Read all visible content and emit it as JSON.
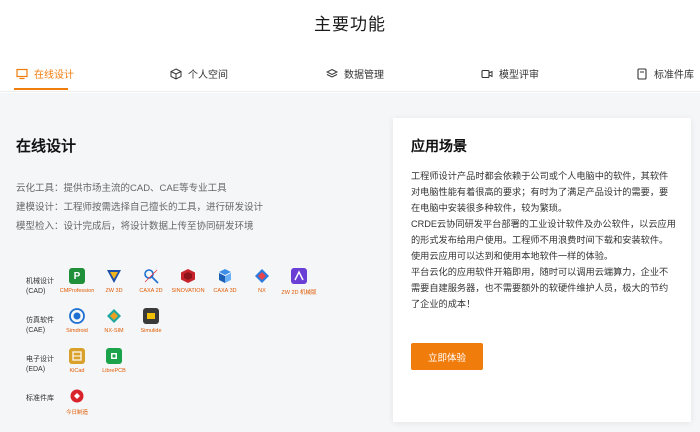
{
  "page": {
    "title": "主要功能"
  },
  "tabs": [
    {
      "label": "在线设计",
      "active": true
    },
    {
      "label": "个人空间",
      "active": false
    },
    {
      "label": "数据管理",
      "active": false
    },
    {
      "label": "模型评审",
      "active": false
    },
    {
      "label": "标准件库",
      "active": false
    }
  ],
  "online_design": {
    "title": "在线设计",
    "lines": [
      "云化工具：提供市场主流的CAD、CAE等专业工具",
      "建模设计：工程师按需选择自己擅长的工具，进行研发设计",
      "模型检入：设计完成后，将设计数据上传至协同研发环境"
    ]
  },
  "categories": [
    {
      "name": "机械设计",
      "abbr": "(CAD)",
      "software": [
        {
          "name": "CMProfession",
          "icon": "cmprofession-icon"
        },
        {
          "name": "ZW 3D",
          "icon": "zw3d-icon"
        },
        {
          "name": "CAXA 2D",
          "icon": "caxa2d-icon"
        },
        {
          "name": "SINOVATION",
          "icon": "sinovation-icon"
        },
        {
          "name": "CAXA 3D",
          "icon": "caxa3d-icon"
        },
        {
          "name": "NX",
          "icon": "nx-icon"
        },
        {
          "name": "ZW 2D 机械版",
          "icon": "zw2d-icon"
        }
      ]
    },
    {
      "name": "仿真软件",
      "abbr": "(CAE)",
      "software": [
        {
          "name": "Simdroid",
          "icon": "simdroid-icon"
        },
        {
          "name": "NX-SIM",
          "icon": "nxsim-icon"
        },
        {
          "name": "Simulide",
          "icon": "simulide-icon"
        }
      ]
    },
    {
      "name": "电子设计",
      "abbr": "(EDA)",
      "software": [
        {
          "name": "KiCad",
          "icon": "kicad-icon"
        },
        {
          "name": "LibrePCB",
          "icon": "librepcb-icon"
        }
      ]
    },
    {
      "name": "标准件库",
      "abbr": "",
      "software": [
        {
          "name": "今日制造",
          "icon": "jinrizhizao-icon"
        }
      ]
    }
  ],
  "scenario": {
    "title": "应用场景",
    "paragraphs": [
      "工程师设计产品时都会依赖于公司或个人电脑中的软件，其软件对电脑性能有着很高的要求；有时为了满足产品设计的需要，要在电脑中安装很多种软件，较为繁琐。",
      "CRDE云协同研发平台部署的工业设计软件及办公软件，以云应用的形式发布给用户使用。工程师不用浪费时间下载和安装软件。使用云应用可以达到和使用本地软件一样的体验。",
      "平台云化的应用软件开箱即用，随时可以调用云端算力，企业不需要自建服务器，也不需要额外的软硬件维护人员，极大的节约了企业的成本！"
    ],
    "cta": "立即体验"
  },
  "colors": {
    "accent": "#f07c0c",
    "panel_bg": "#f5f6f8"
  }
}
